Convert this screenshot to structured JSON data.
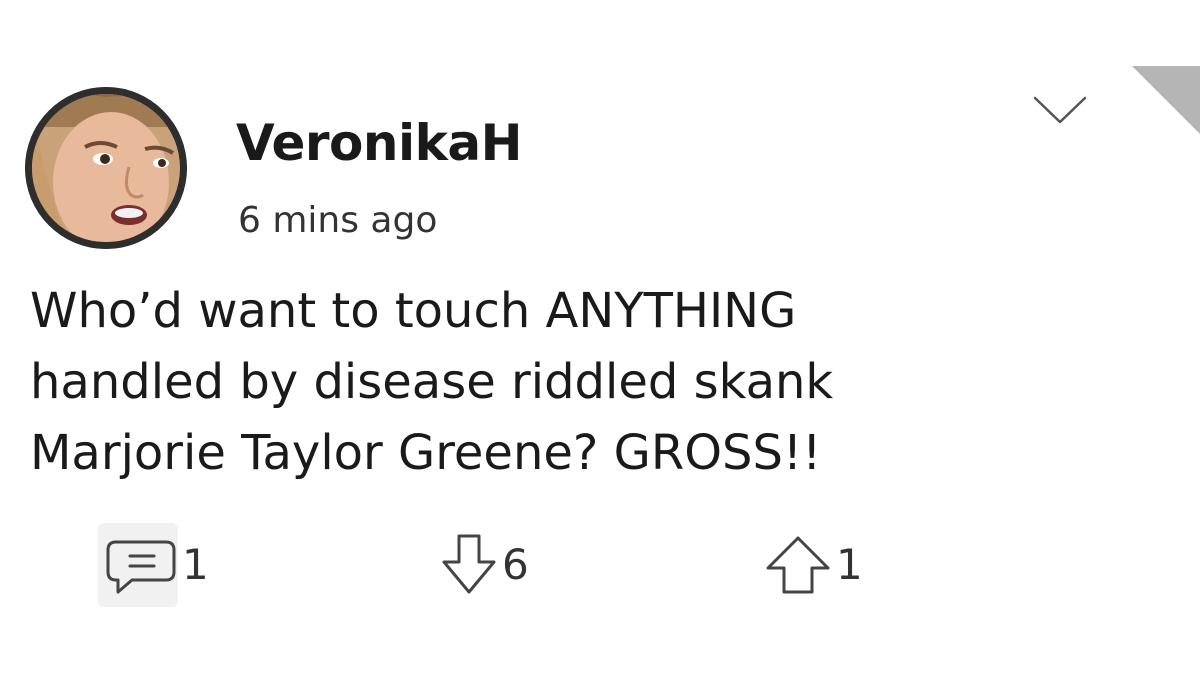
{
  "post": {
    "username": "VeronikaH",
    "timestamp": "6 mins ago",
    "avatar_icon": "user-photo-avatar",
    "body_lines": [
      "Who’d want to touch ANYTHING",
      "handled by disease riddled skank",
      "Marjorie Taylor Greene? GROSS!!"
    ]
  },
  "actions": {
    "reply": {
      "icon": "comment-icon",
      "count": "1"
    },
    "downvote": {
      "icon": "arrow-down-icon",
      "count": "6"
    },
    "upvote": {
      "icon": "arrow-up-icon",
      "count": "1"
    }
  },
  "menu": {
    "icon": "chevron-down-icon"
  },
  "colors": {
    "background": "#ffffff",
    "text": "#1a1a1a",
    "secondary_text": "#333333",
    "icon_stroke": "#444444"
  }
}
